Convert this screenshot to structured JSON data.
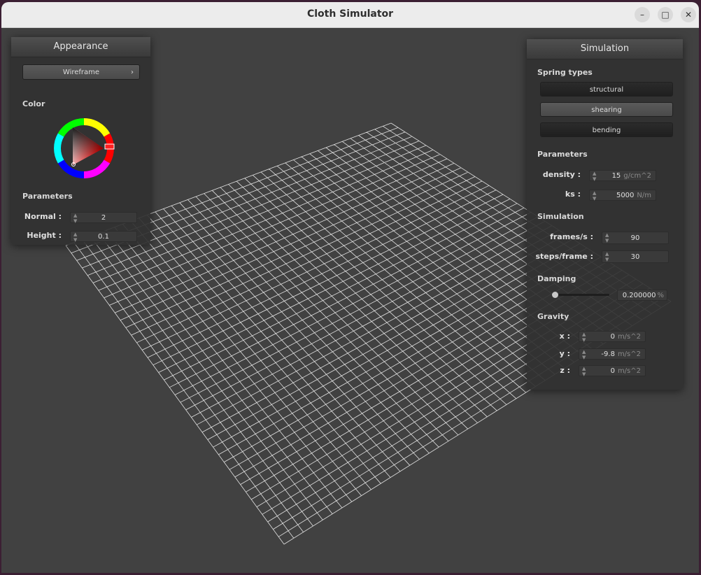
{
  "window": {
    "title": "Cloth Simulator"
  },
  "appearance": {
    "title": "Appearance",
    "shader_label": "Wireframe",
    "color_label": "Color",
    "params_label": "Parameters",
    "normal_label": "Normal :",
    "normal_value": "2",
    "height_label": "Height :",
    "height_value": "0.1"
  },
  "simulation": {
    "title": "Simulation",
    "spring_types_label": "Spring types",
    "springs": [
      "structural",
      "shearing",
      "bending"
    ],
    "params_label": "Parameters",
    "density_label": "density :",
    "density_value": "15",
    "density_unit": "g/cm^2",
    "ks_label": "ks :",
    "ks_value": "5000",
    "ks_unit": "N/m",
    "sim_label": "Simulation",
    "fps_label": "frames/s :",
    "fps_value": "90",
    "steps_label": "steps/frame :",
    "steps_value": "30",
    "damping_label": "Damping",
    "damping_value": "0.200000",
    "damping_unit": "%",
    "damping_fraction": 0.0,
    "gravity_label": "Gravity",
    "gx_label": "x :",
    "gx_value": "0",
    "gy_label": "y :",
    "gy_value": "-9.8",
    "gz_label": "z :",
    "gz_value": "0",
    "gravity_unit": "m/s^2"
  },
  "colors": {
    "cloth": "#ffffff",
    "background": "#414141"
  },
  "icons": {
    "dropdown": "chevron-right-icon",
    "minimize": "minimize-icon",
    "maximize": "maximize-icon",
    "close": "close-icon"
  }
}
